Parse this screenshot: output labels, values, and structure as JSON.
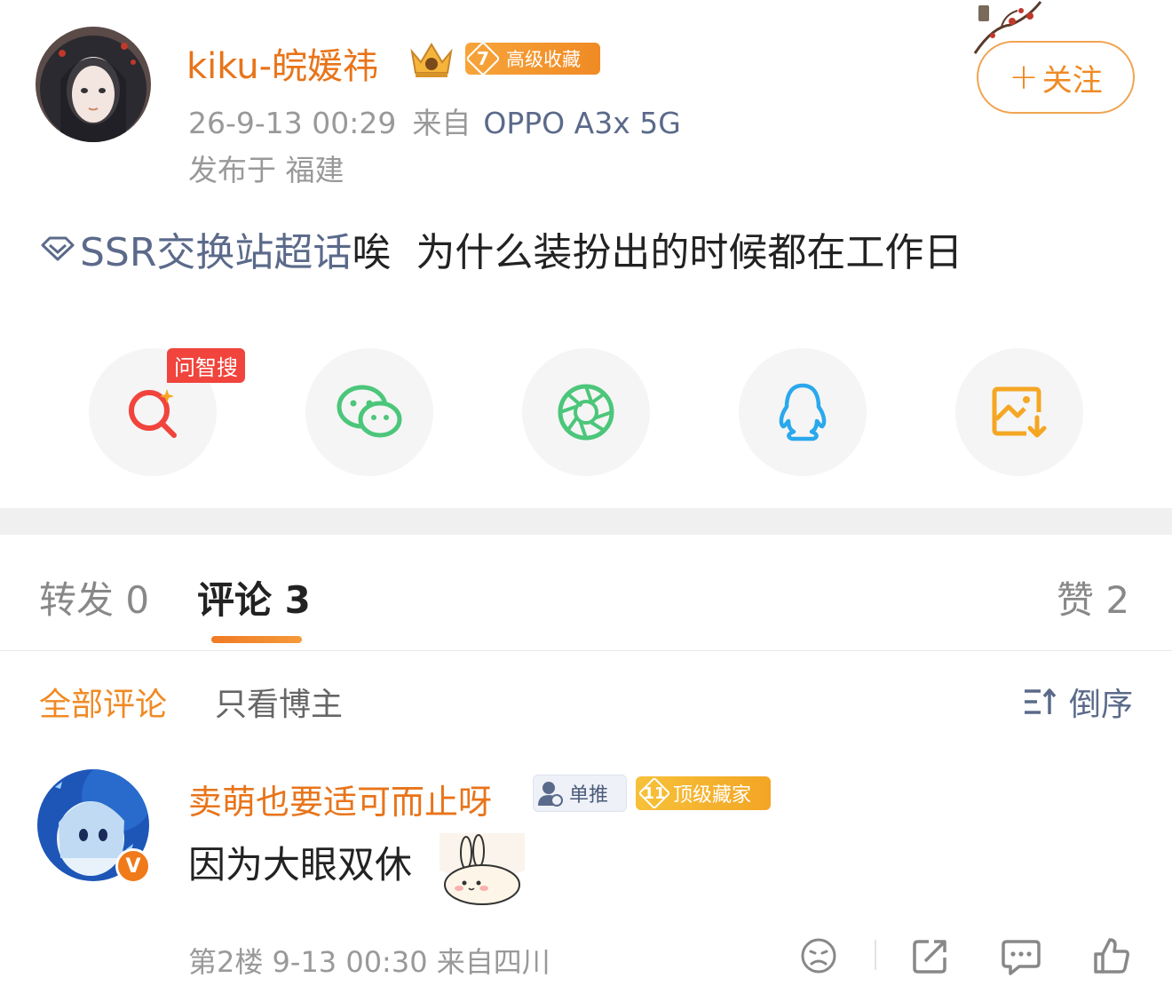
{
  "post": {
    "username": "kiku-皖媛祎",
    "collect_badge_level": "7",
    "collect_badge_label": "高级收藏",
    "timestamp": "26-9-13 00:29",
    "from_label": "来自",
    "device": "OPPO A3x 5G",
    "location": "发布于 福建",
    "follow_button": "关注",
    "follow_plus": "+",
    "topic": "SSR交换站超话",
    "text": "唉  为什么装扮出的时候都在工作日"
  },
  "share": {
    "ai_tag": "问智搜",
    "items": [
      {
        "icon": "ai-search-icon",
        "color": "#f0443c"
      },
      {
        "icon": "wechat-icon",
        "color": "#4cc67a"
      },
      {
        "icon": "moments-icon",
        "color": "#4cc67a"
      },
      {
        "icon": "qq-icon",
        "color": "#2aa8ec"
      },
      {
        "icon": "save-image-icon",
        "color": "#f5a623"
      }
    ]
  },
  "tabs": {
    "repost": "转发 0",
    "comments": "评论 3",
    "likes": "赞 2"
  },
  "filters": {
    "all": "全部评论",
    "author_only": "只看博主",
    "sort": "倒序"
  },
  "comment": {
    "username": "卖萌也要适可而止呀",
    "fan_badge": "单推",
    "top_badge_level": "11",
    "top_badge_label": "顶级藏家",
    "text": "因为大眼双休",
    "meta": "第2楼 9-13 00:30 来自四川"
  },
  "colors": {
    "accent": "#f08a24",
    "username": "#e8741a",
    "link": "#5b6a8a"
  }
}
